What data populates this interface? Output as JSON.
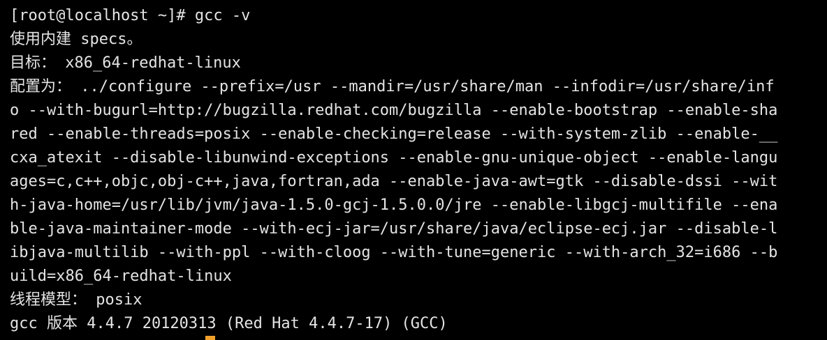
{
  "terminal": {
    "top_fragment": {
      "left_text": "              ",
      "tags": []
    },
    "lines": [
      "[root@localhost ~]# gcc -v",
      "使用内建 specs。",
      "目标： x86_64-redhat-linux",
      "配置为： ../configure --prefix=/usr --mandir=/usr/share/man --infodir=/usr/share/inf",
      "o --with-bugurl=http://bugzilla.redhat.com/bugzilla --enable-bootstrap --enable-sha",
      "red --enable-threads=posix --enable-checking=release --with-system-zlib --enable-__",
      "cxa_atexit --disable-libunwind-exceptions --enable-gnu-unique-object --enable-langu",
      "ages=c,c++,objc,obj-c++,java,fortran,ada --enable-java-awt=gtk --disable-dssi --wit",
      "h-java-home=/usr/lib/jvm/java-1.5.0-gcj-1.5.0.0/jre --enable-libgcj-multifile --ena",
      "ble-java-maintainer-mode --with-ecj-jar=/usr/share/java/eclipse-ecj.jar --disable-l",
      "ibjava-multilib --with-ppl --with-cloog --with-tune=generic --with-arch_32=i686 --b",
      "uild=x86_64-redhat-linux",
      "线程模型： posix",
      "gcc 版本 4.4.7 20120313 (Red Hat 4.4.7-17) (GCC)"
    ],
    "colors": {
      "background": "#000000",
      "text": "#e4e4e4",
      "cursor": "#f0a02a"
    }
  }
}
